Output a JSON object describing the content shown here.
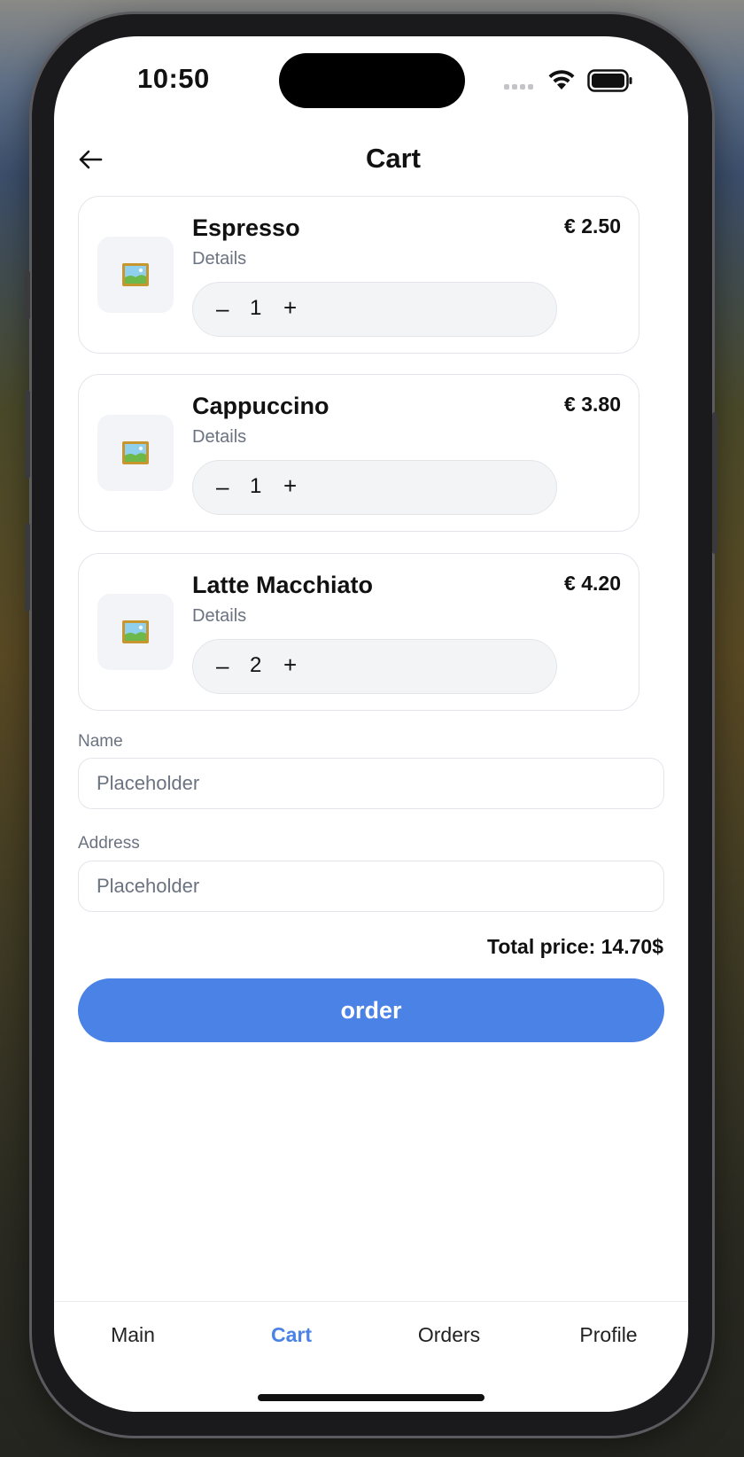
{
  "status_bar": {
    "time": "10:50"
  },
  "header": {
    "title": "Cart",
    "back_icon": "arrow-left-icon"
  },
  "cart": {
    "items": [
      {
        "name": "Espresso",
        "details": "Details",
        "price": "€ 2.50",
        "quantity": "1",
        "image_icon": "framed-picture-icon"
      },
      {
        "name": "Cappuccino",
        "details": "Details",
        "price": "€ 3.80",
        "quantity": "1",
        "image_icon": "framed-picture-icon"
      },
      {
        "name": "Latte Macchiato",
        "details": "Details",
        "price": "€ 4.20",
        "quantity": "2",
        "image_icon": "framed-picture-icon"
      }
    ],
    "stepper": {
      "minus": "–",
      "plus": "+"
    }
  },
  "form": {
    "name": {
      "label": "Name",
      "placeholder": "Placeholder",
      "value": ""
    },
    "address": {
      "label": "Address",
      "placeholder": "Placeholder",
      "value": ""
    }
  },
  "summary": {
    "total": "Total price: 14.70$"
  },
  "order_button": {
    "label": "order"
  },
  "tabbar": {
    "tabs": [
      {
        "label": "Main"
      },
      {
        "label": "Cart",
        "active": true
      },
      {
        "label": "Orders"
      },
      {
        "label": "Profile"
      }
    ]
  },
  "colors": {
    "accent": "#4a82e6",
    "muted_text": "#6b7280",
    "card_border": "#e2e5ea"
  }
}
